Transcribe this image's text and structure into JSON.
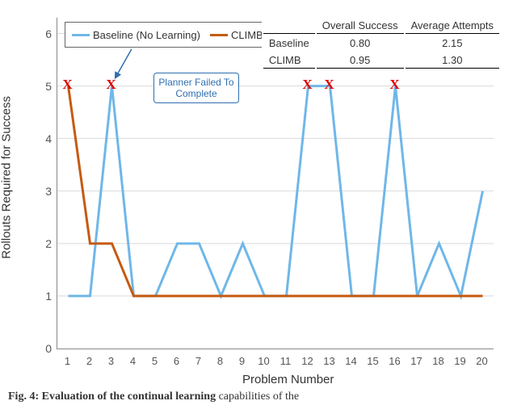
{
  "chart_data": {
    "type": "line",
    "title": "",
    "xlabel": "Problem Number",
    "ylabel": "Rollouts Required for Success",
    "xlim": [
      0.5,
      20.5
    ],
    "ylim": [
      0,
      6.3
    ],
    "yticks": [
      0,
      1,
      2,
      3,
      4,
      5,
      6
    ],
    "categories": [
      1,
      2,
      3,
      4,
      5,
      6,
      7,
      8,
      9,
      10,
      11,
      12,
      13,
      14,
      15,
      16,
      17,
      18,
      19,
      20
    ],
    "series": [
      {
        "name": "Baseline (No Learning)",
        "color": "#6fb7e8",
        "values": [
          1,
          1,
          5,
          1,
          1,
          2,
          2,
          1,
          2,
          1,
          1,
          5,
          5,
          1,
          1,
          5,
          1,
          2,
          1,
          3
        ]
      },
      {
        "name": "CLIMB",
        "color": "#c55a11",
        "values": [
          5,
          2,
          2,
          1,
          1,
          1,
          1,
          1,
          1,
          1,
          1,
          1,
          1,
          1,
          1,
          1,
          1,
          1,
          1,
          1
        ]
      }
    ],
    "failure_marker": {
      "label": "X",
      "color": "#dc0000",
      "legend": "Planner Failed To Complete",
      "points": [
        {
          "series": "CLIMB",
          "x": 1
        },
        {
          "series": "Baseline (No Learning)",
          "x": 3
        },
        {
          "series": "Baseline (No Learning)",
          "x": 12
        },
        {
          "series": "Baseline (No Learning)",
          "x": 13
        },
        {
          "series": "Baseline (No Learning)",
          "x": 16
        }
      ]
    },
    "summary_table": {
      "columns": [
        "",
        "Overall Success",
        "Average Attempts"
      ],
      "rows": [
        [
          "Baseline",
          "0.80",
          "2.15"
        ],
        [
          "CLIMB",
          "0.95",
          "1.30"
        ]
      ]
    }
  },
  "caption": {
    "prefix": "Fig. 4: Evaluation of the continual learning",
    "rest": " capabilities of the"
  }
}
